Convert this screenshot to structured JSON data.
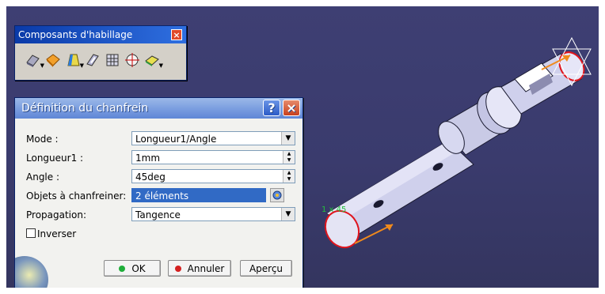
{
  "toolbar": {
    "title": "Composants d'habillage",
    "close_glyph": "×",
    "tools": [
      {
        "name": "fillet-icon",
        "has_arrow": true
      },
      {
        "name": "chamfer-icon",
        "has_arrow": false
      },
      {
        "name": "draft-icon",
        "has_arrow": true
      },
      {
        "name": "shell-icon",
        "has_arrow": false
      },
      {
        "name": "thickness-icon",
        "has_arrow": false
      },
      {
        "name": "thread-icon",
        "has_arrow": false
      },
      {
        "name": "remove-face-icon",
        "has_arrow": true
      }
    ]
  },
  "dialog": {
    "title": "Définition du chanfrein",
    "help_glyph": "?",
    "close_glyph": "×",
    "fields": {
      "mode": {
        "label": "Mode :",
        "value": "Longueur1/Angle"
      },
      "length": {
        "label": "Longueur1 :",
        "value": "1mm"
      },
      "angle": {
        "label": "Angle :",
        "value": "45deg"
      },
      "objects": {
        "label": "Objets à chanfreiner:",
        "value": "2 éléments"
      },
      "propagation": {
        "label": "Propagation:",
        "value": "Tangence"
      }
    },
    "inverse_label": "Inverser",
    "inverse_checked": false,
    "buttons": {
      "ok": "OK",
      "cancel": "Annuler",
      "preview": "Aperçu"
    }
  },
  "viewport": {
    "dimension_label": "1 x 45"
  },
  "colors": {
    "viewport_bg": "#3a3b6d",
    "dialog_title": "#7c9fe0",
    "selection": "#316ac5",
    "part_fill": "#d6d6ef",
    "edge_red": "#e0141c",
    "arrow_orange": "#f08a1c",
    "label_green": "#23c23a"
  }
}
